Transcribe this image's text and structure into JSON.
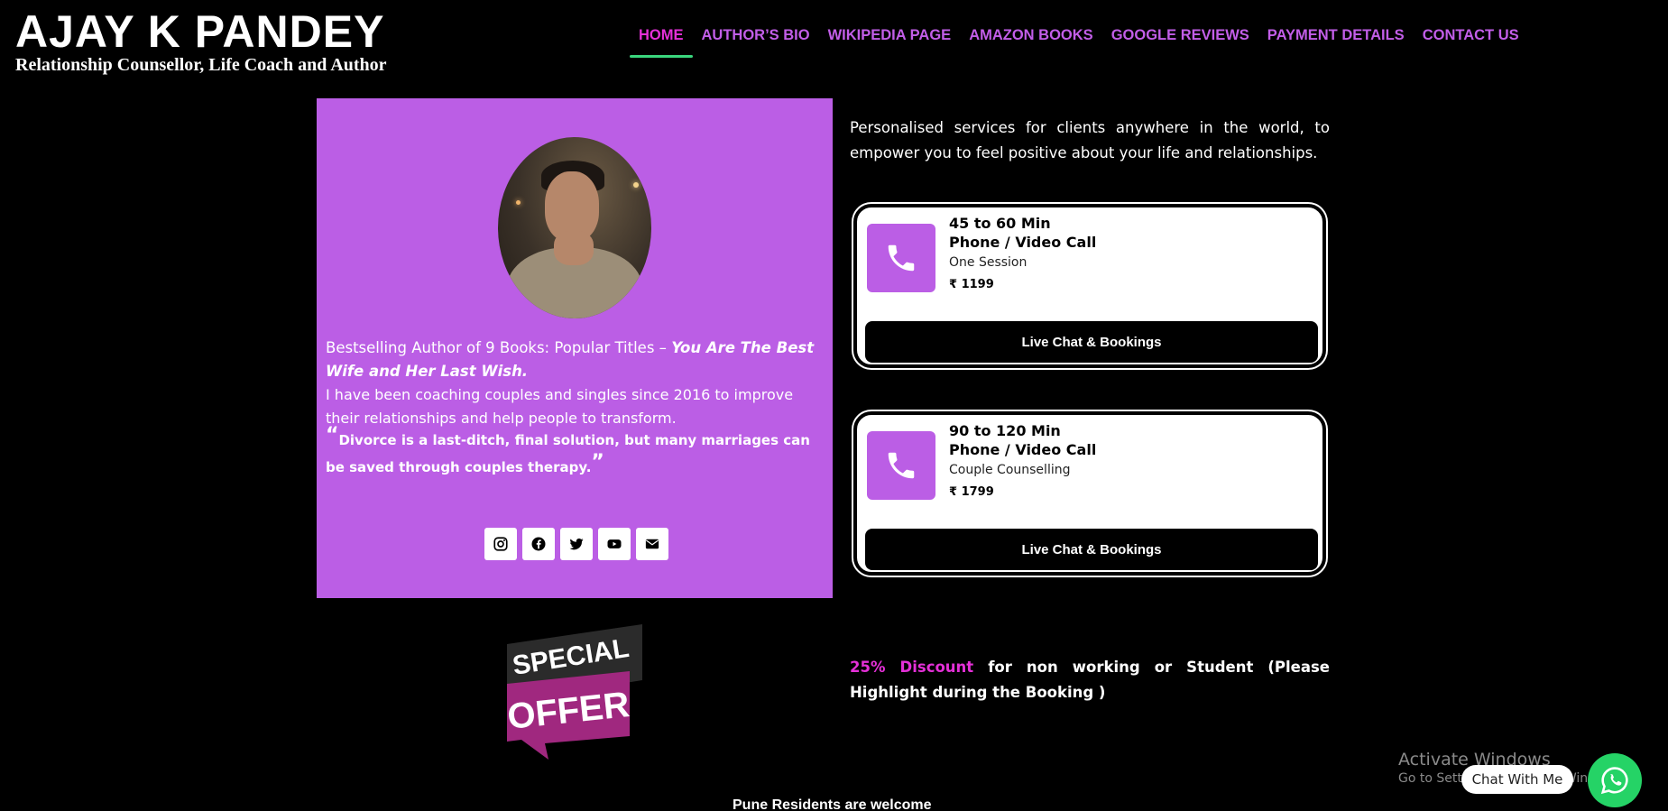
{
  "header": {
    "title": "AJAY K PANDEY",
    "subtitle": "Relationship Counsellor, Life Coach and Author"
  },
  "nav": {
    "items": [
      {
        "label": "HOME",
        "active": true
      },
      {
        "label": "AUTHOR’S BIO"
      },
      {
        "label": "WIKIPEDIA PAGE"
      },
      {
        "label": "AMAZON BOOKS"
      },
      {
        "label": "GOOGLE REVIEWS"
      },
      {
        "label": "PAYMENT DETAILS"
      },
      {
        "label": "CONTACT US"
      }
    ]
  },
  "bio": {
    "intro_prefix": "Bestselling Author of 9 Books: Popular Titles – ",
    "intro_titles": "You Are The Best Wife and Her Last Wish.",
    "coaching": "I have been coaching couples and singles since 2016 to improve their relationships and help people to transform.",
    "quote": "Divorce is a last-ditch, final solution, but many marriages can be saved through couples therapy.",
    "quote_open": "“",
    "quote_close": "”"
  },
  "socials": [
    {
      "icon": "instagram-icon"
    },
    {
      "icon": "facebook-icon"
    },
    {
      "icon": "twitter-icon"
    },
    {
      "icon": "youtube-icon"
    },
    {
      "icon": "envelope-icon"
    }
  ],
  "services": {
    "intro": "Personalised services for clients anywhere in the world, to empower you to feel positive about your life and relationships.",
    "cards": [
      {
        "duration": "45 to 60 Min",
        "type": "Phone / Video Call",
        "detail": "One Session",
        "price": "₹ 1199",
        "button": "Live Chat & Bookings"
      },
      {
        "duration": "90 to 120 Min",
        "type": "Phone / Video Call",
        "detail": "Couple Counselling",
        "price": "₹ 1799",
        "button": "Live Chat & Bookings"
      }
    ]
  },
  "offer": {
    "badge_top": "SPECIAL",
    "badge_bottom": "OFFER",
    "discount_highlight": "25% Discount",
    "discount_text": " for non working or Student (Please Highlight during the Booking )"
  },
  "footer_note": "Pune Residents are welcome",
  "watermark": {
    "line1": "Activate Windows",
    "line2": "Go to Settings to activate Windows."
  },
  "chat": {
    "label": "Chat With Me"
  },
  "colors": {
    "accent_purple": "#bb5ee5",
    "nav_purple": "#c25ee8",
    "active_pink": "#e530d8",
    "active_underline": "#3ad67d",
    "whatsapp_green": "#25d366"
  }
}
